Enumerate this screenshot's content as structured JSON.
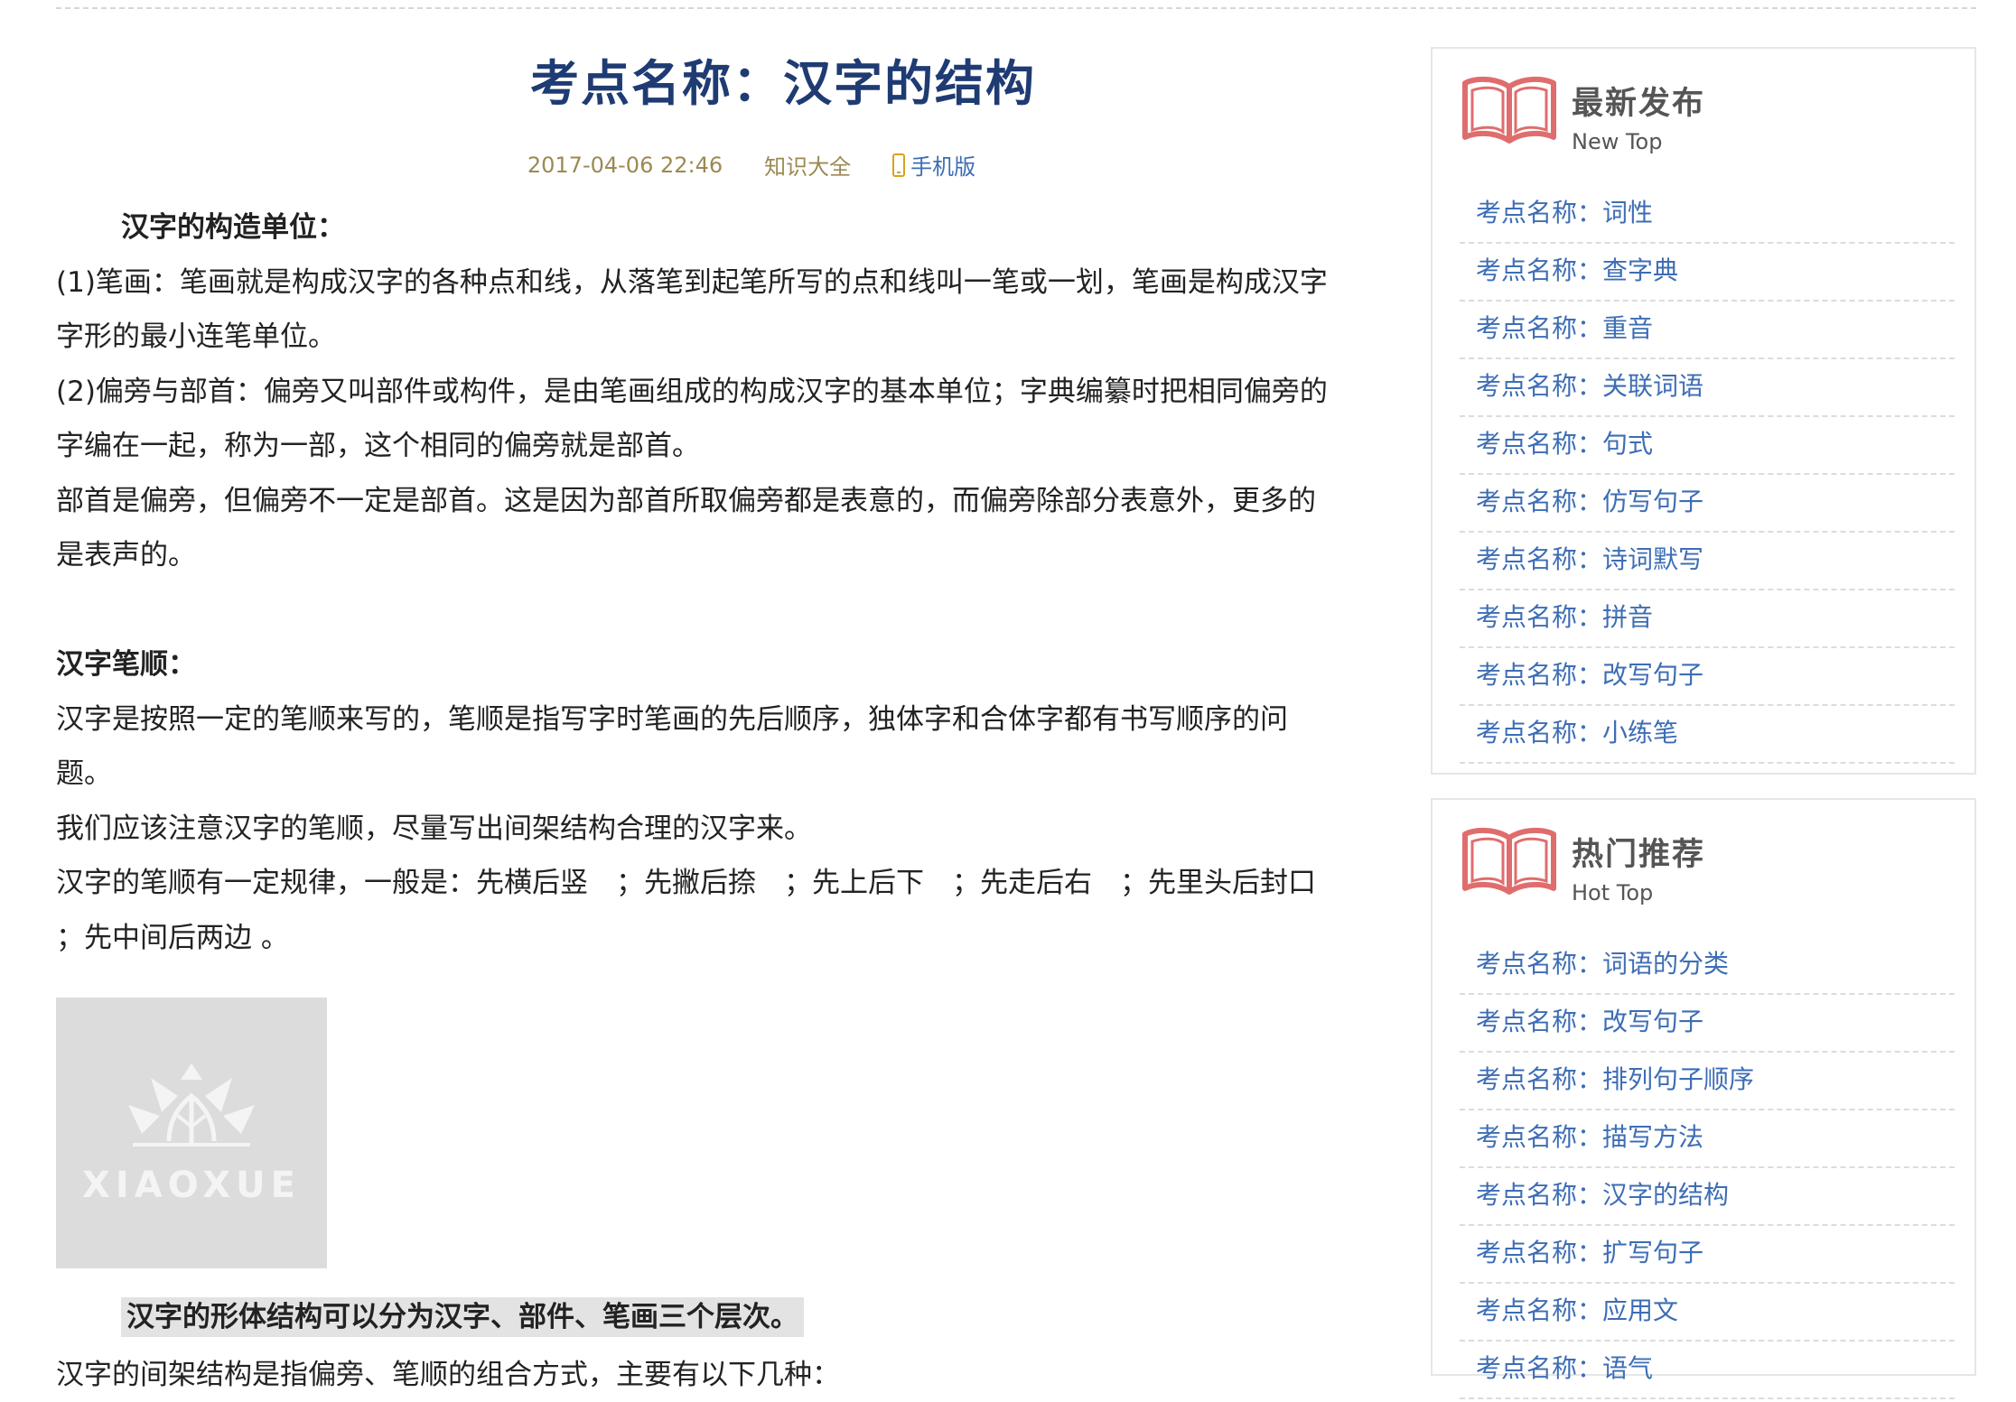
{
  "article": {
    "title": "考点名称：汉字的结构",
    "date": "2017-04-06 22:46",
    "category": "知识大全",
    "mobile_label": "手机版",
    "paragraphs": [
      "汉字的构造单位：",
      "(1)笔画：笔画就是构成汉字的各种点和线，从落笔到起笔所写的点和线叫一笔或一划，笔画是构成汉字",
      "字形的最小连笔单位。",
      "(2)偏旁与部首：偏旁又叫部件或构件，是由笔画组成的构成汉字的基本单位；字典编纂时把相同偏旁的",
      "字编在一起，称为一部，这个相同的偏旁就是部首。",
      "部首是偏旁，但偏旁不一定是部首。这是因为部首所取偏旁都是表意的，而偏旁除部分表意外，更多的",
      "是表声的。",
      "汉字笔顺：",
      "汉字是按照一定的笔顺来写的，笔顺是指写字时笔画的先后顺序，独体字和合体字都有书写顺序的问",
      "题。",
      "我们应该注意汉字的笔顺，尽量写出间架结构合理的汉字来。",
      "汉字的笔顺有一定规律，一般是：先横后竖　；先撇后捺　；先上后下　；先走后右　；先里头后封口",
      "；先中间后两边 。"
    ],
    "image_logo_text": "XIAOXUE",
    "highlight": "汉字的形体结构可以分为汉字、部件、笔画三个层次。",
    "cut_line": "汉字的间架结构是指偏旁、笔顺的组合方式，主要有以下几种："
  },
  "sidebar": {
    "latest": {
      "title": "最新发布",
      "subtitle": "New Top",
      "items": [
        "考点名称：词性",
        "考点名称：查字典",
        "考点名称：重音",
        "考点名称：关联词语",
        "考点名称：句式",
        "考点名称：仿写句子",
        "考点名称：诗词默写",
        "考点名称：拼音",
        "考点名称：改写句子",
        "考点名称：小练笔"
      ]
    },
    "hot": {
      "title": "热门推荐",
      "subtitle": "Hot Top",
      "items": [
        "考点名称：词语的分类",
        "考点名称：改写句子",
        "考点名称：排列句子顺序",
        "考点名称：描写方法",
        "考点名称：汉字的结构",
        "考点名称：扩写句子",
        "考点名称：应用文",
        "考点名称：语气"
      ]
    }
  },
  "colors": {
    "title": "#1f3b73",
    "link": "#3d6db5",
    "meta": "#9b8a52",
    "book_icon": "#e06d6d"
  }
}
